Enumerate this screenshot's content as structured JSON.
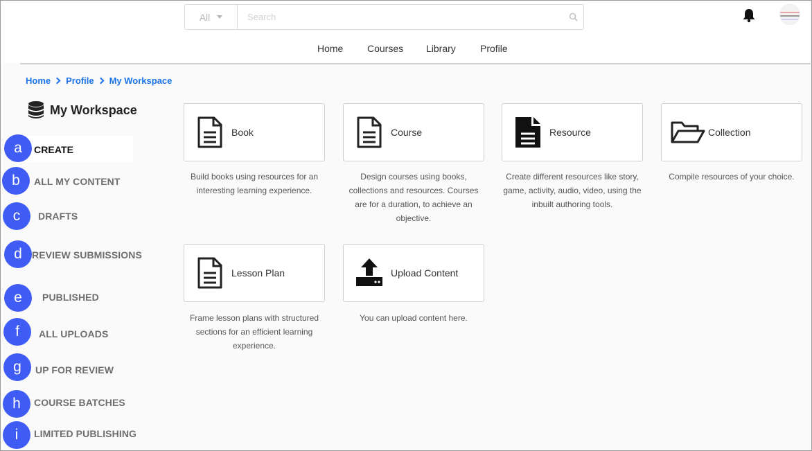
{
  "search": {
    "scope_value": "All",
    "placeholder": "Search"
  },
  "nav": {
    "items": [
      "Home",
      "Courses",
      "Library",
      "Profile"
    ]
  },
  "breadcrumb": [
    "Home",
    "Profile",
    "My Workspace"
  ],
  "workspace": {
    "title": "My Workspace",
    "icon": "database-icon"
  },
  "sidebar": {
    "items": [
      {
        "badge": "a",
        "label": "CREATE"
      },
      {
        "badge": "b",
        "label": "ALL MY CONTENT"
      },
      {
        "badge": "c",
        "label": "DRAFTS"
      },
      {
        "badge": "d",
        "label": "REVIEW SUBMISSIONS"
      },
      {
        "badge": "e",
        "label": "PUBLISHED"
      },
      {
        "badge": "f",
        "label": "ALL UPLOADS"
      },
      {
        "badge": "g",
        "label": "UP FOR REVIEW"
      },
      {
        "badge": "h",
        "label": "COURSE BATCHES"
      },
      {
        "badge": "i",
        "label": "LIMITED PUBLISHING"
      }
    ]
  },
  "cards": [
    {
      "label": "Book",
      "icon": "document-outline-icon",
      "description": "Build books using resources for an interesting learning experience."
    },
    {
      "label": "Course",
      "icon": "document-outline-icon",
      "description": "Design courses using books, collections and resources. Courses are for a duration, to achieve an objective."
    },
    {
      "label": "Resource",
      "icon": "document-filled-icon",
      "description": "Create different resources like story, game, activity, audio, video, using the inbuilt authoring tools."
    },
    {
      "label": "Collection",
      "icon": "folder-open-icon",
      "description": "Compile resources of your choice."
    },
    {
      "label": "Lesson Plan",
      "icon": "document-outline-icon",
      "description": "Frame lesson plans with structured sections for an efficient learning experience."
    },
    {
      "label": "Upload Content",
      "icon": "upload-icon",
      "description": "You can upload content here."
    }
  ],
  "colors": {
    "badge": "#3f5cf5",
    "link": "#1a73e8"
  }
}
